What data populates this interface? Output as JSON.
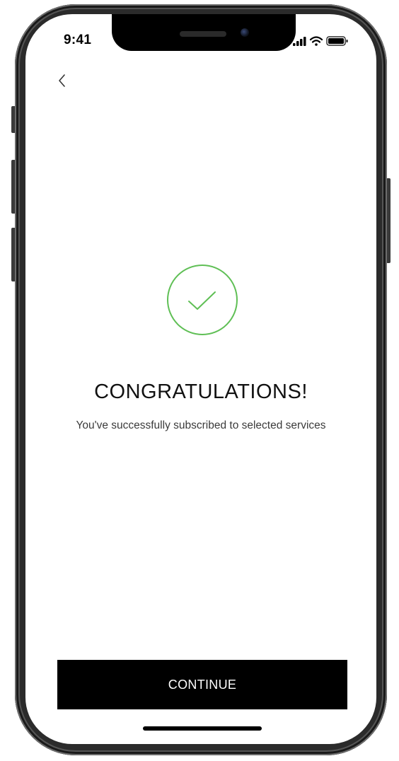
{
  "status_bar": {
    "time": "9:41",
    "icons": [
      "cellular-signal-icon",
      "wifi-icon",
      "battery-icon"
    ]
  },
  "navigation": {
    "back_icon": "chevron-left-icon"
  },
  "success": {
    "icon": "checkmark-circle-icon",
    "accent_color": "#5fbf55",
    "title": "CONGRATULATIONS!",
    "message": "You've successfully subscribed to selected services"
  },
  "actions": {
    "continue_label": "CONTINUE"
  },
  "colors": {
    "background": "#ffffff",
    "button_background": "#000000",
    "button_text": "#ffffff",
    "text_primary": "#111111"
  }
}
